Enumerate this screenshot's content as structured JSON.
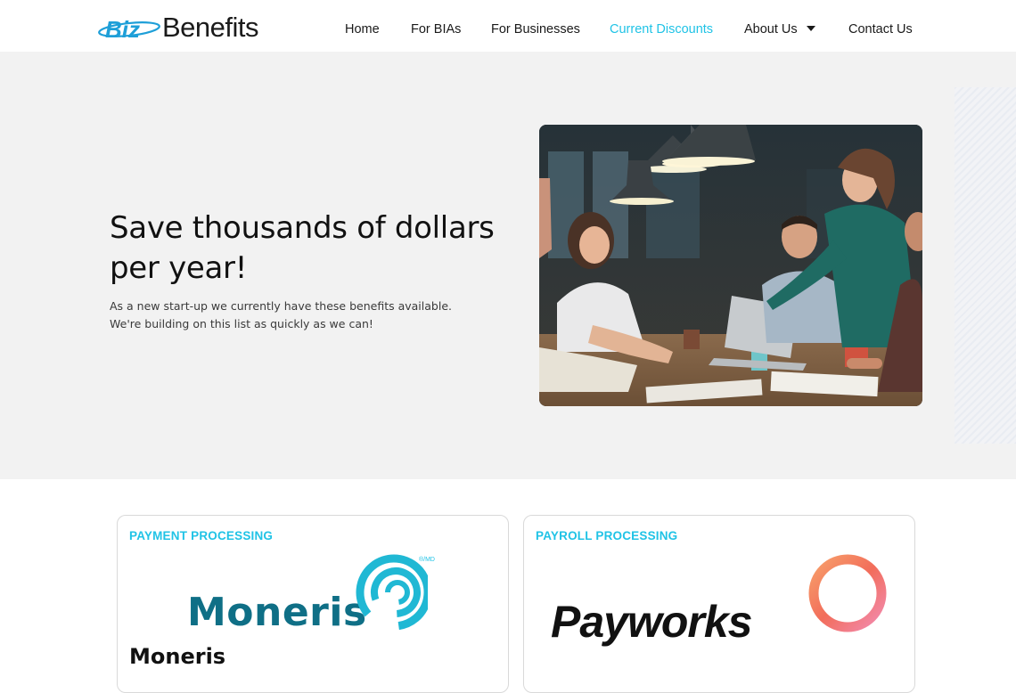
{
  "header": {
    "logo_prefix": "Biz",
    "logo_word": "Benefits",
    "nav": [
      {
        "label": "Home"
      },
      {
        "label": "For BIAs"
      },
      {
        "label": "For Businesses"
      },
      {
        "label": "Current Discounts",
        "active": true
      },
      {
        "label": "About Us",
        "has_dropdown": true
      },
      {
        "label": "Contact Us"
      }
    ]
  },
  "hero": {
    "title": "Save thousands of dollars per year!",
    "subtitle": "As a new start-up we currently have these benefits available. We're building on this list as quickly as we can!"
  },
  "cards": [
    {
      "category": "PAYMENT PROCESSING",
      "logo_text": "Moneris",
      "logo_mark": "®/MD",
      "name": "Moneris"
    },
    {
      "category": "PAYROLL PROCESSING",
      "logo_text": "Payworks"
    }
  ],
  "colors": {
    "accent": "#20c3e6",
    "hero_bg": "#f2f2f2",
    "moneris_teal": "#0f6f86"
  }
}
